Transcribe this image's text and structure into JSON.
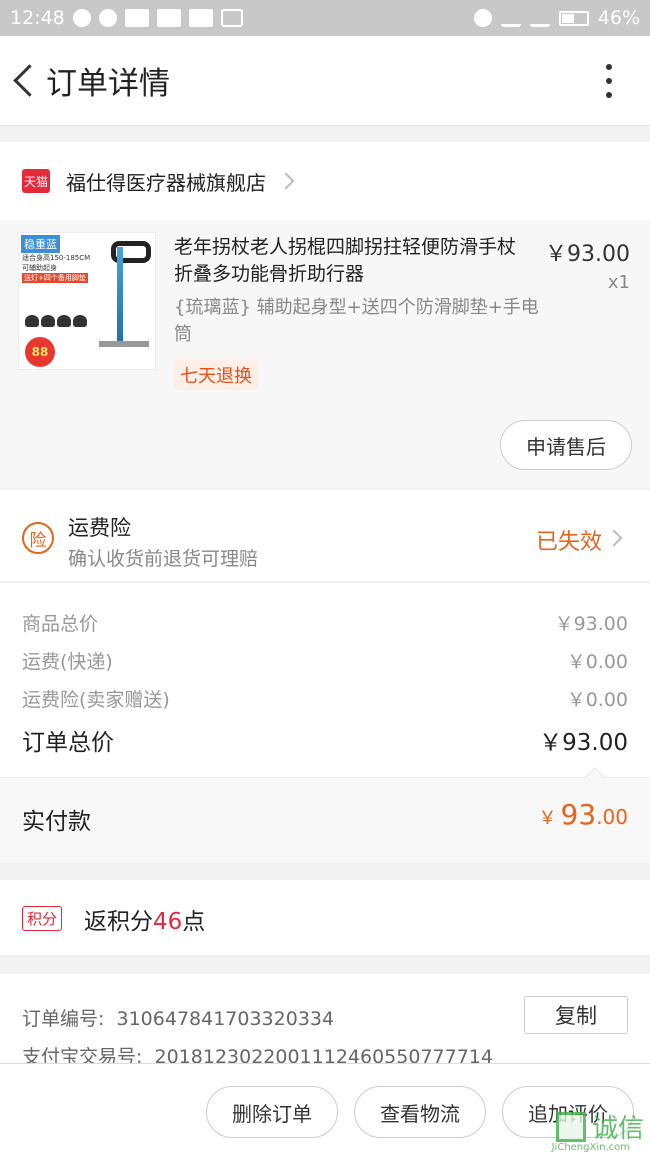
{
  "status_bar": {
    "time": "12:48",
    "battery": "46%",
    "battery_level": 0.46
  },
  "header": {
    "title": "订单详情"
  },
  "shop": {
    "badge": "天猫",
    "name": "福仕得医疗器械旗舰店"
  },
  "product": {
    "thumbnail": {
      "tag": "稳重蓝",
      "line1": "适合身高150-185CM",
      "line2": "可辅助起身",
      "line3": "送灯+四个备用脚垫",
      "price_badge": "88"
    },
    "name": "老年拐杖老人拐棍四脚拐拄轻便防滑手杖折叠多功能骨折助行器",
    "price": "￥93.00",
    "quantity": "x1",
    "sku": "{琉璃蓝} 辅助起身型+送四个防滑脚垫+手电筒",
    "return_tag": "七天退换",
    "after_sale_button": "申请售后"
  },
  "insurance": {
    "icon_label": "险",
    "title": "运费险",
    "subtitle": "确认收货前退货可理赔",
    "status": "已失效"
  },
  "summary": {
    "rows": [
      {
        "label": "商品总价",
        "value": "￥93.00"
      },
      {
        "label": "运费(快递)",
        "value": "￥0.00"
      },
      {
        "label": "运费险(卖家赠送)",
        "value": "￥0.00"
      }
    ],
    "total_label": "订单总价",
    "total_value": "￥93.00"
  },
  "payment": {
    "label": "实付款",
    "currency": "￥",
    "integer": "93",
    "decimal": ".00"
  },
  "points": {
    "badge": "积分",
    "prefix": "返积分",
    "amount": "46",
    "suffix": "点"
  },
  "order_info": {
    "order_no_label": "订单编号:",
    "order_no": "310647841703320334",
    "alipay_label": "支付宝交易号:",
    "alipay_no": "2018123022001112460550777714",
    "copy_button": "复制"
  },
  "bottom_actions": {
    "delete": "删除订单",
    "logistics": "查看物流",
    "review": "追加评价"
  },
  "watermark": {
    "text": "诚信",
    "sub": "JiChengXin.com"
  },
  "colors": {
    "accent": "#e8631a",
    "tmall_red": "#e5293a"
  }
}
